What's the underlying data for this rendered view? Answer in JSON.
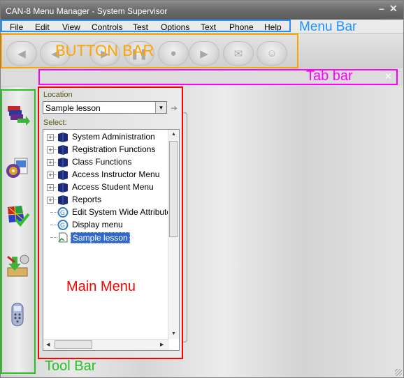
{
  "window": {
    "title": "CAN-8 Menu Manager - System Supervisor"
  },
  "menu": {
    "items": [
      "File",
      "Edit",
      "View",
      "Controls",
      "Test",
      "Options",
      "Text",
      "Phone",
      "Help"
    ]
  },
  "annotations": {
    "menu_bar": "Menu Bar",
    "button_bar": "BUTTON BAR",
    "tab_bar": "Tab bar",
    "main_menu": "Main Menu",
    "tool_bar": "Tool Bar",
    "colors": {
      "blue": "#1e90ff",
      "orange": "#ffa500",
      "magenta": "#ff00ff",
      "red": "#ff0000",
      "green": "#22c422"
    }
  },
  "main_menu": {
    "location_label": "Location",
    "location_value": "Sample lesson",
    "select_label": "Select:",
    "tree": [
      {
        "label": "System Administration",
        "type": "book",
        "expandable": true,
        "selected": false
      },
      {
        "label": "Registration Functions",
        "type": "book",
        "expandable": true,
        "selected": false
      },
      {
        "label": "Class Functions",
        "type": "book",
        "expandable": true,
        "selected": false
      },
      {
        "label": "Access Instructor Menu",
        "type": "book",
        "expandable": true,
        "selected": false
      },
      {
        "label": "Access Student Menu",
        "type": "book",
        "expandable": true,
        "selected": false
      },
      {
        "label": "Reports",
        "type": "book",
        "expandable": true,
        "selected": false
      },
      {
        "label": "Edit System Wide Attribute",
        "type": "attribute",
        "expandable": false,
        "selected": false
      },
      {
        "label": "Display menu",
        "type": "attribute",
        "expandable": false,
        "selected": false
      },
      {
        "label": "Sample lesson",
        "type": "lesson",
        "expandable": false,
        "selected": true
      }
    ]
  }
}
